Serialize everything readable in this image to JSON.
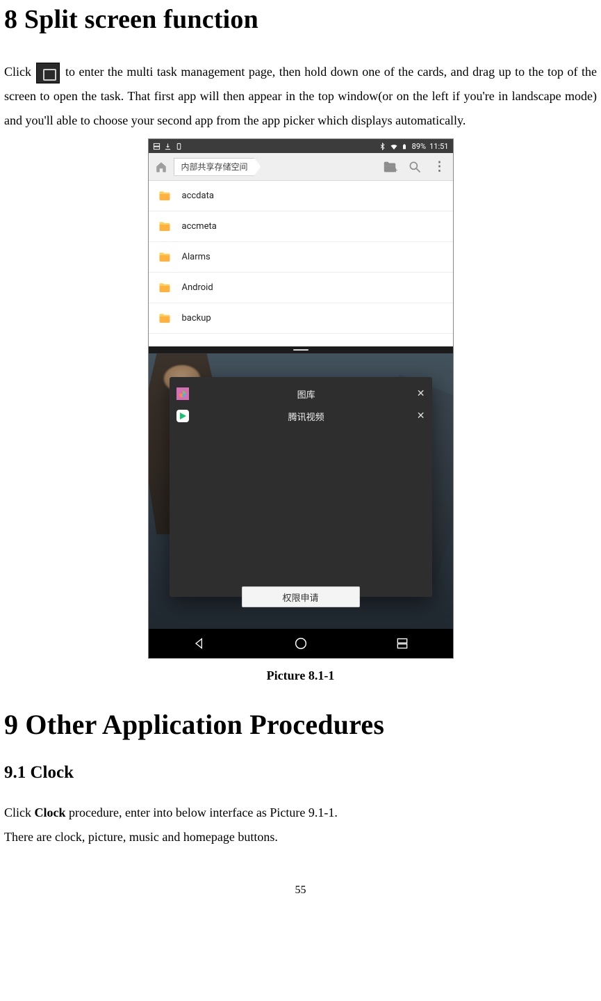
{
  "heading1": "8 Split screen function",
  "para1_pre": "Click ",
  "para1_post": " to enter the multi task management page, then hold down one of the cards, and drag up to the top of the screen to open the task. That first app will then appear in the top window(or on the left if you're in landscape mode) and you'll able to choose your second app from the app picker which displays automatically.",
  "figure": {
    "statusbar": {
      "battery": "89%",
      "time": "11:51"
    },
    "breadcrumb": "内部共享存储空间",
    "folders": [
      "accdata",
      "accmeta",
      "Alarms",
      "Android",
      "backup"
    ],
    "card_apps": [
      {
        "label": "图库"
      },
      {
        "label": "腾讯视频"
      }
    ],
    "perm_button": "权限申请",
    "caption": "Picture 8.1-1"
  },
  "heading2": "9 Other Application Procedures",
  "subheading": "9.1   Clock",
  "body_line1_pre": "Click ",
  "body_line1_bold": "Clock",
  "body_line1_post": " procedure, enter into below interface as Picture 9.1-1.",
  "body_line2": "There are clock, picture, music and homepage buttons.",
  "page_number": "55"
}
